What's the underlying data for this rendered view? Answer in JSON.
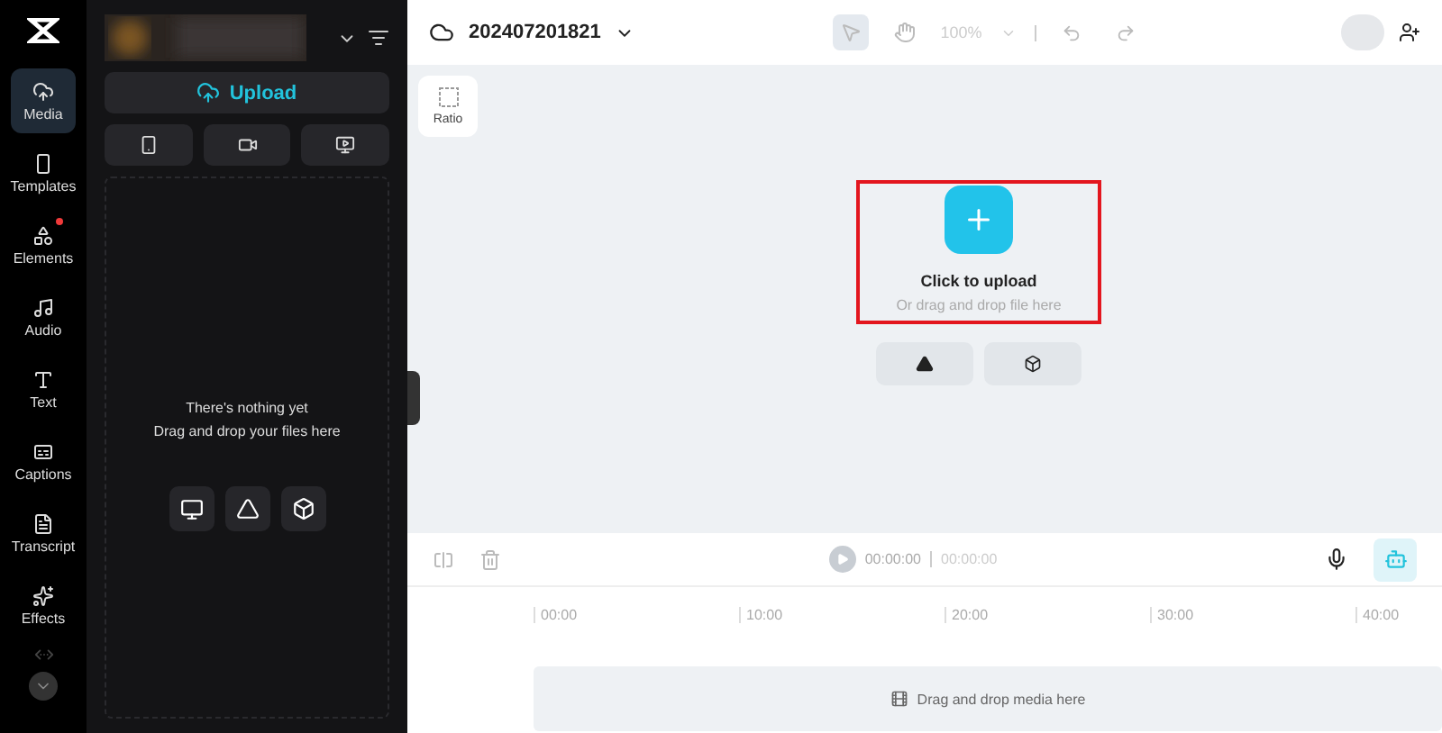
{
  "sidebar": {
    "items": [
      {
        "label": "Media",
        "selected": true,
        "badge": false
      },
      {
        "label": "Templates",
        "selected": false,
        "badge": false
      },
      {
        "label": "Elements",
        "selected": false,
        "badge": true
      },
      {
        "label": "Audio",
        "selected": false,
        "badge": false
      },
      {
        "label": "Text",
        "selected": false,
        "badge": false
      },
      {
        "label": "Captions",
        "selected": false,
        "badge": false
      },
      {
        "label": "Transcript",
        "selected": false,
        "badge": false
      },
      {
        "label": "Effects",
        "selected": false,
        "badge": false
      }
    ]
  },
  "media_panel": {
    "upload_button": "Upload",
    "empty_title": "There's nothing yet",
    "empty_hint": "Drag and drop your files here"
  },
  "topbar": {
    "project_name": "202407201821",
    "zoom": "100%"
  },
  "canvas": {
    "ratio_label": "Ratio",
    "upload_title": "Click to upload",
    "upload_hint": "Or drag and drop file here"
  },
  "timeline": {
    "current_time": "00:00:00",
    "total_time": "00:00:00",
    "ticks": [
      "00:00",
      "10:00",
      "20:00",
      "30:00",
      "40:00"
    ],
    "track_hint": "Drag and drop media here"
  }
}
